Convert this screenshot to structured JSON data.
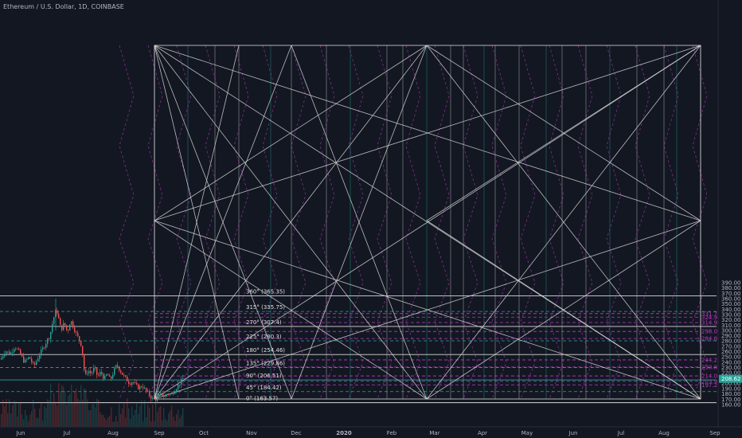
{
  "window": {
    "title": "Ethereum / U.S. Dollar, 1D, COINBASE"
  },
  "colors": {
    "background": "#131722",
    "grid_white": "#d8d8d8",
    "teal": "#26a69a",
    "magenta": "#c038c8",
    "up_candle": "#26a69a",
    "down_candle": "#ef5350",
    "axis_text": "#b2b5be",
    "price_badge": "#26a69a"
  },
  "axis": {
    "price_ticks": [
      "390.00",
      "380.00",
      "370.00",
      "360.00",
      "350.00",
      "340.00",
      "330.00",
      "320.00",
      "310.00",
      "300.00",
      "290.00",
      "280.00",
      "270.00",
      "260.00",
      "250.00",
      "240.00",
      "230.00",
      "220.00",
      "210.00",
      "200.00",
      "190.00",
      "180.00",
      "170.00",
      "160.00"
    ],
    "time_ticks": [
      "Jun",
      "Jul",
      "Aug",
      "Sep",
      "Oct",
      "Nov",
      "Dec",
      "2020",
      "Feb",
      "Mar",
      "Apr",
      "May",
      "Jun",
      "Jul",
      "Aug",
      "Sep"
    ],
    "current_price": "208.62"
  },
  "gann_levels": [
    {
      "label": "360° (365.35)"
    },
    {
      "label": "315° (335.75)"
    },
    {
      "label": "270° (307.4)"
    },
    {
      "label": "225° (280.3)"
    },
    {
      "label": "180° (254.46)"
    },
    {
      "label": "135° (229.86)"
    },
    {
      "label": "90° (206.51)"
    },
    {
      "label": "45° (184.42)"
    },
    {
      "label": "0° (163.57)"
    }
  ],
  "magenta_labels": [
    "331.72",
    "324.99",
    "314.9",
    "298.09",
    "284.64",
    "244.28",
    "230.83",
    "214.01",
    "203.93",
    "197.2"
  ],
  "chart_data": {
    "type": "candlestick",
    "title": "Ethereum / U.S. Dollar, 1D, COINBASE",
    "ylim": [
      155,
      395
    ],
    "current_price": 208.62,
    "gann_prices": [
      365.35,
      335.75,
      307.4,
      280.3,
      254.46,
      229.86,
      206.51,
      184.42,
      163.57
    ],
    "magenta_prices": [
      331.72,
      324.99,
      314.9,
      298.09,
      284.64,
      244.28,
      230.83,
      214.01,
      203.93,
      197.2
    ],
    "price_path": [
      [
        0,
        245
      ],
      [
        6,
        262
      ],
      [
        12,
        255
      ],
      [
        18,
        270
      ],
      [
        24,
        258
      ],
      [
        30,
        240
      ],
      [
        36,
        250
      ],
      [
        42,
        232
      ],
      [
        48,
        252
      ],
      [
        54,
        268
      ],
      [
        58,
        280
      ],
      [
        62,
        290
      ],
      [
        66,
        320
      ],
      [
        70,
        340
      ],
      [
        73,
        322
      ],
      [
        76,
        300
      ],
      [
        80,
        315
      ],
      [
        84,
        296
      ],
      [
        88,
        320
      ],
      [
        92,
        305
      ],
      [
        96,
        290
      ],
      [
        99,
        282
      ],
      [
        102,
        270
      ],
      [
        104,
        240
      ],
      [
        106,
        212
      ],
      [
        110,
        225
      ],
      [
        114,
        218
      ],
      [
        118,
        230
      ],
      [
        122,
        212
      ],
      [
        126,
        222
      ],
      [
        130,
        208
      ],
      [
        134,
        218
      ],
      [
        138,
        206
      ],
      [
        142,
        222
      ],
      [
        146,
        235
      ],
      [
        150,
        225
      ],
      [
        154,
        215
      ],
      [
        158,
        208
      ],
      [
        162,
        200
      ],
      [
        166,
        204
      ],
      [
        170,
        196
      ],
      [
        174,
        191
      ],
      [
        178,
        196
      ],
      [
        182,
        187
      ],
      [
        186,
        180
      ],
      [
        190,
        172
      ],
      [
        194,
        168
      ],
      [
        198,
        176
      ],
      [
        202,
        180
      ],
      [
        206,
        174
      ],
      [
        210,
        182
      ],
      [
        214,
        178
      ],
      [
        218,
        186
      ],
      [
        222,
        194
      ],
      [
        226,
        202
      ],
      [
        230,
        212
      ]
    ]
  }
}
